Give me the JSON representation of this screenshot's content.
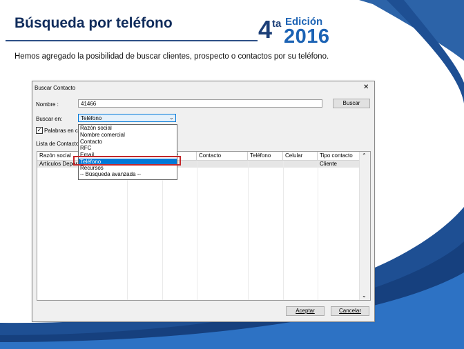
{
  "slide": {
    "title": "Búsqueda por teléfono",
    "edition_number": "4",
    "edition_superscript": "ta",
    "edition_word": "Edición",
    "edition_year": "2016",
    "subtitle": "Hemos agregado la posibilidad de buscar clientes, prospecto o contactos por su teléfono."
  },
  "dialog": {
    "title": "Buscar Contacto",
    "close_glyph": "✕",
    "name_label": "Nombre :",
    "name_value": "41466",
    "search_button": "Buscar",
    "search_in_label": "Buscar en:",
    "search_in_selected": "Teléfono",
    "whole_words_label": "Palabras en c",
    "list_label": "Lista de Contacto",
    "accept_button": "Aceptar",
    "cancel_button": "Cancelar"
  },
  "dropdown": {
    "options": [
      "Razón social",
      "Nombre comercial",
      "Contacto",
      "RFC",
      "Email",
      "Teléfono",
      "Recursos",
      "-- Búsqueda avanzada --"
    ],
    "selected_option": "Teléfono"
  },
  "grid": {
    "columns": [
      "Razón social",
      "",
      "ono 2",
      "Contacto",
      "Teléfono",
      "Celular",
      "Tipo contacto"
    ],
    "rows": [
      {
        "razon_social": "Artículos Depor",
        "tipo_contacto": "Cliente"
      }
    ]
  },
  "colors": {
    "title": "#0f2b5b",
    "accent_blue": "#1c63b4",
    "highlight": "#0078d7",
    "callout_red": "#c3272a"
  },
  "icons": [
    "close-icon",
    "chevron-down-icon",
    "checkbox-check-icon",
    "scroll-up-icon",
    "scroll-down-icon"
  ]
}
